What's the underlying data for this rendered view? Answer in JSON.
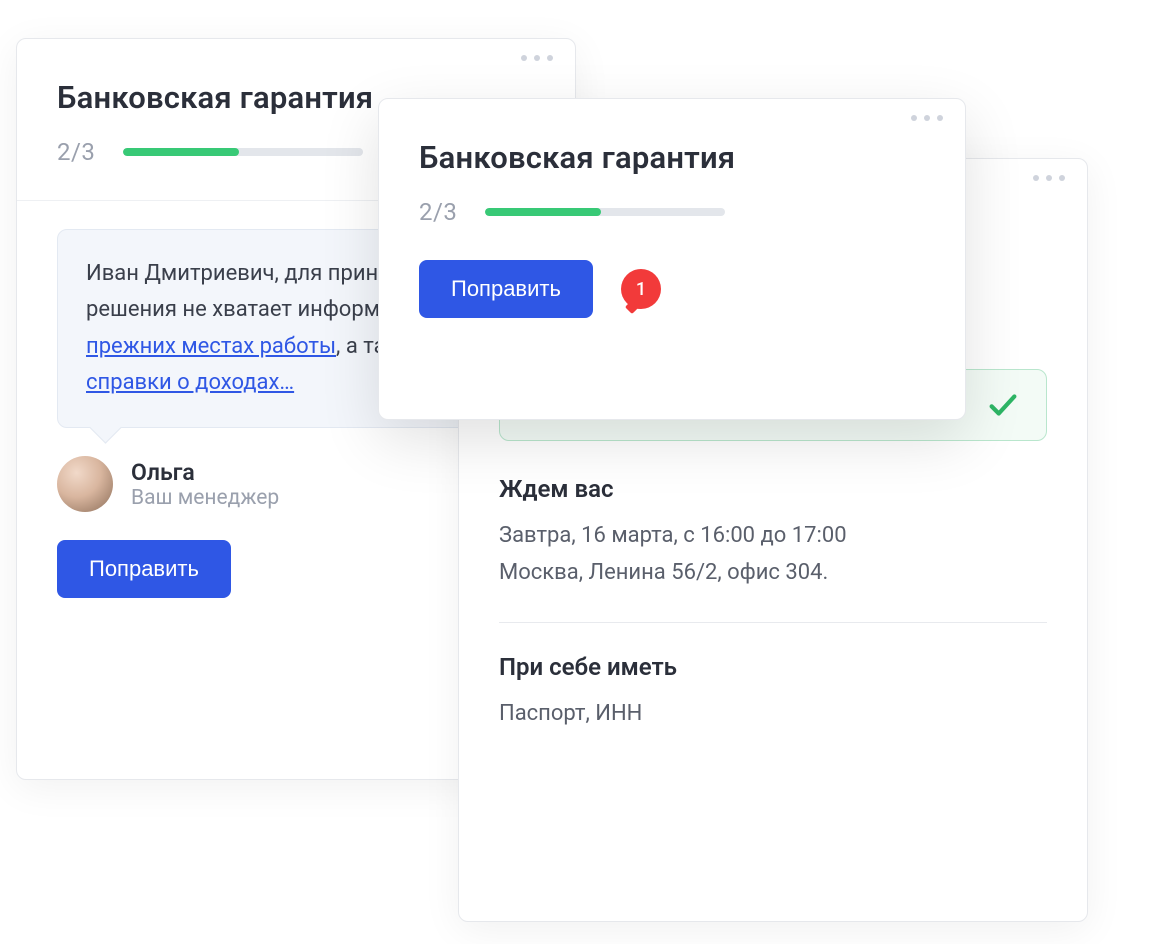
{
  "left": {
    "title": "Банковская гарантия",
    "progress": "2/3",
    "message": {
      "text_prefix": "Иван Дмитриевич, для принятия решения не хватает информации о ",
      "link1": "прежних местах работы",
      "mid": ", а также ",
      "link2": "справки о доходах…"
    },
    "manager": {
      "name": "Ольга",
      "role": "Ваш менеджер"
    },
    "button": "Поправить"
  },
  "top": {
    "title": "Банковская гарантия",
    "progress": "2/3",
    "button": "Поправить",
    "notif_count": "1"
  },
  "right": {
    "wait_title": "Ждем вас",
    "wait_line1": "Завтра, 16 марта, с 16:00 до 17:00",
    "wait_line2": "Москва, Ленина 56/2, офис 304.",
    "bring_title": "При себе иметь",
    "bring_text": "Паспорт, ИНН"
  }
}
